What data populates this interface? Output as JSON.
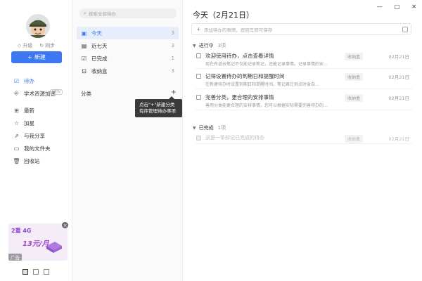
{
  "sidebar": {
    "upgrade": "升级",
    "sync": "同步",
    "new_button": "新建",
    "items": [
      {
        "label": "待办",
        "icon": "check-square-icon",
        "active": true
      },
      {
        "label": "学术资源加速",
        "icon": "academic-icon",
        "badge": "NEW"
      },
      {
        "label": "最新",
        "icon": "grid-icon"
      },
      {
        "label": "加星",
        "icon": "star-icon"
      },
      {
        "label": "与我分享",
        "icon": "share-icon"
      },
      {
        "label": "我的文件夹",
        "icon": "folder-icon"
      },
      {
        "label": "回收站",
        "icon": "trash-icon"
      }
    ],
    "ad": {
      "headline": "2重 4G",
      "offer": "13元/月",
      "label": "广告"
    }
  },
  "middle": {
    "search_placeholder": "搜索全部待办",
    "items": [
      {
        "label": "今天",
        "count": "3",
        "icon": "calendar-today-icon",
        "active": true
      },
      {
        "label": "近七天",
        "count": "3",
        "icon": "calendar-week-icon"
      },
      {
        "label": "已完成",
        "count": "1",
        "icon": "check-box-icon"
      },
      {
        "label": "收纳盒",
        "count": "3",
        "icon": "inbox-icon"
      }
    ],
    "section_label": "分类",
    "tooltip_line1": "点击\"+\"新建分类",
    "tooltip_line2": "有序管理待办事项"
  },
  "main": {
    "title": "今天（2月21日）",
    "add_placeholder": "添加待办的事情，按回车即可保存",
    "in_progress": {
      "label": "进行中",
      "count": "3项"
    },
    "tasks": [
      {
        "title": "欢迎使用待办，点击查看详情",
        "desc": "现在有道云笔记不仅能记录笔记，还能记录事情。记录事情的安...",
        "tag": "收纳盒",
        "date": "02月21日"
      },
      {
        "title": "记得设置待办的到期日和提醒时间",
        "desc": "在新建待办时设置到期日和提醒时间，笔记君在到点时会自...",
        "tag": "收纳盒",
        "date": "02月21日"
      },
      {
        "title": "完善分类，更合理的安排事情",
        "desc": "善用分类能更合理的安排事情，您可以根据实际需要完善待办的...",
        "tag": "收纳盒",
        "date": "02月21日"
      }
    ],
    "completed": {
      "label": "已完成",
      "count": "1项"
    },
    "done_task": {
      "title": "这是一条标记已完成的待办",
      "tag": "收纳盒",
      "date": "02月21日"
    },
    "window": {
      "minimize": "—",
      "maximize": "□",
      "close": "✕"
    }
  },
  "colors": {
    "accent": "#3d78f2"
  }
}
